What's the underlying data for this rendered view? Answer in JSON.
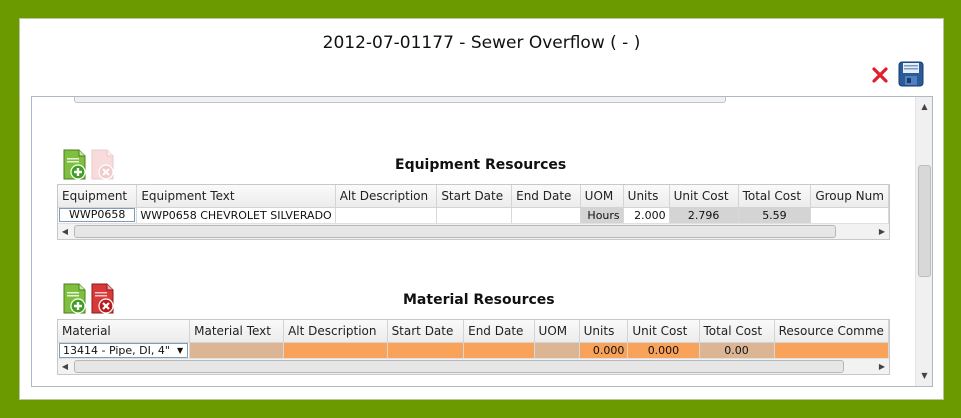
{
  "window": {
    "title": "2012-07-01177 - Sewer Overflow ( - )"
  },
  "toolbar": {
    "close_icon": "close-x-icon",
    "save_icon": "floppy-save-icon",
    "close_color": "#e0202a",
    "save_color": "#2a5a9a"
  },
  "equipment": {
    "title": "Equipment Resources",
    "add_icon": "add-document-icon",
    "remove_icon": "remove-document-icon",
    "remove_state": "disabled",
    "columns": [
      "Equipment",
      "Equipment Text",
      "Alt Description",
      "Start Date",
      "End Date",
      "UOM",
      "Units",
      "Unit Cost",
      "Total Cost",
      "Group Num"
    ],
    "row": {
      "equipment": "WWP0658",
      "equipment_text": "WWP0658 CHEVROLET SILVERADO",
      "alt_description": "",
      "start_date": "",
      "end_date": "",
      "uom": "Hours",
      "units": "2.000",
      "unit_cost": "2.796",
      "total_cost": "5.59",
      "group_num": ""
    }
  },
  "material": {
    "title": "Material Resources",
    "add_icon": "add-document-icon",
    "remove_icon": "remove-document-icon",
    "remove_state": "enabled",
    "columns": [
      "Material",
      "Material Text",
      "Alt Description",
      "Start Date",
      "End Date",
      "UOM",
      "Units",
      "Unit Cost",
      "Total Cost",
      "Resource Comme"
    ],
    "row": {
      "material": "13414 - Pipe, DI, 4\"",
      "material_text": "",
      "alt_description": "",
      "start_date": "",
      "end_date": "",
      "uom": "",
      "units": "0.000",
      "unit_cost": "0.000",
      "total_cost": "0.00",
      "resource_comment": ""
    }
  },
  "colors": {
    "frame_green": "#6a9a00",
    "required_orange": "#f9a25a",
    "readonly_tan": "#dcb595",
    "readonly_gray": "#d4d4d4"
  }
}
